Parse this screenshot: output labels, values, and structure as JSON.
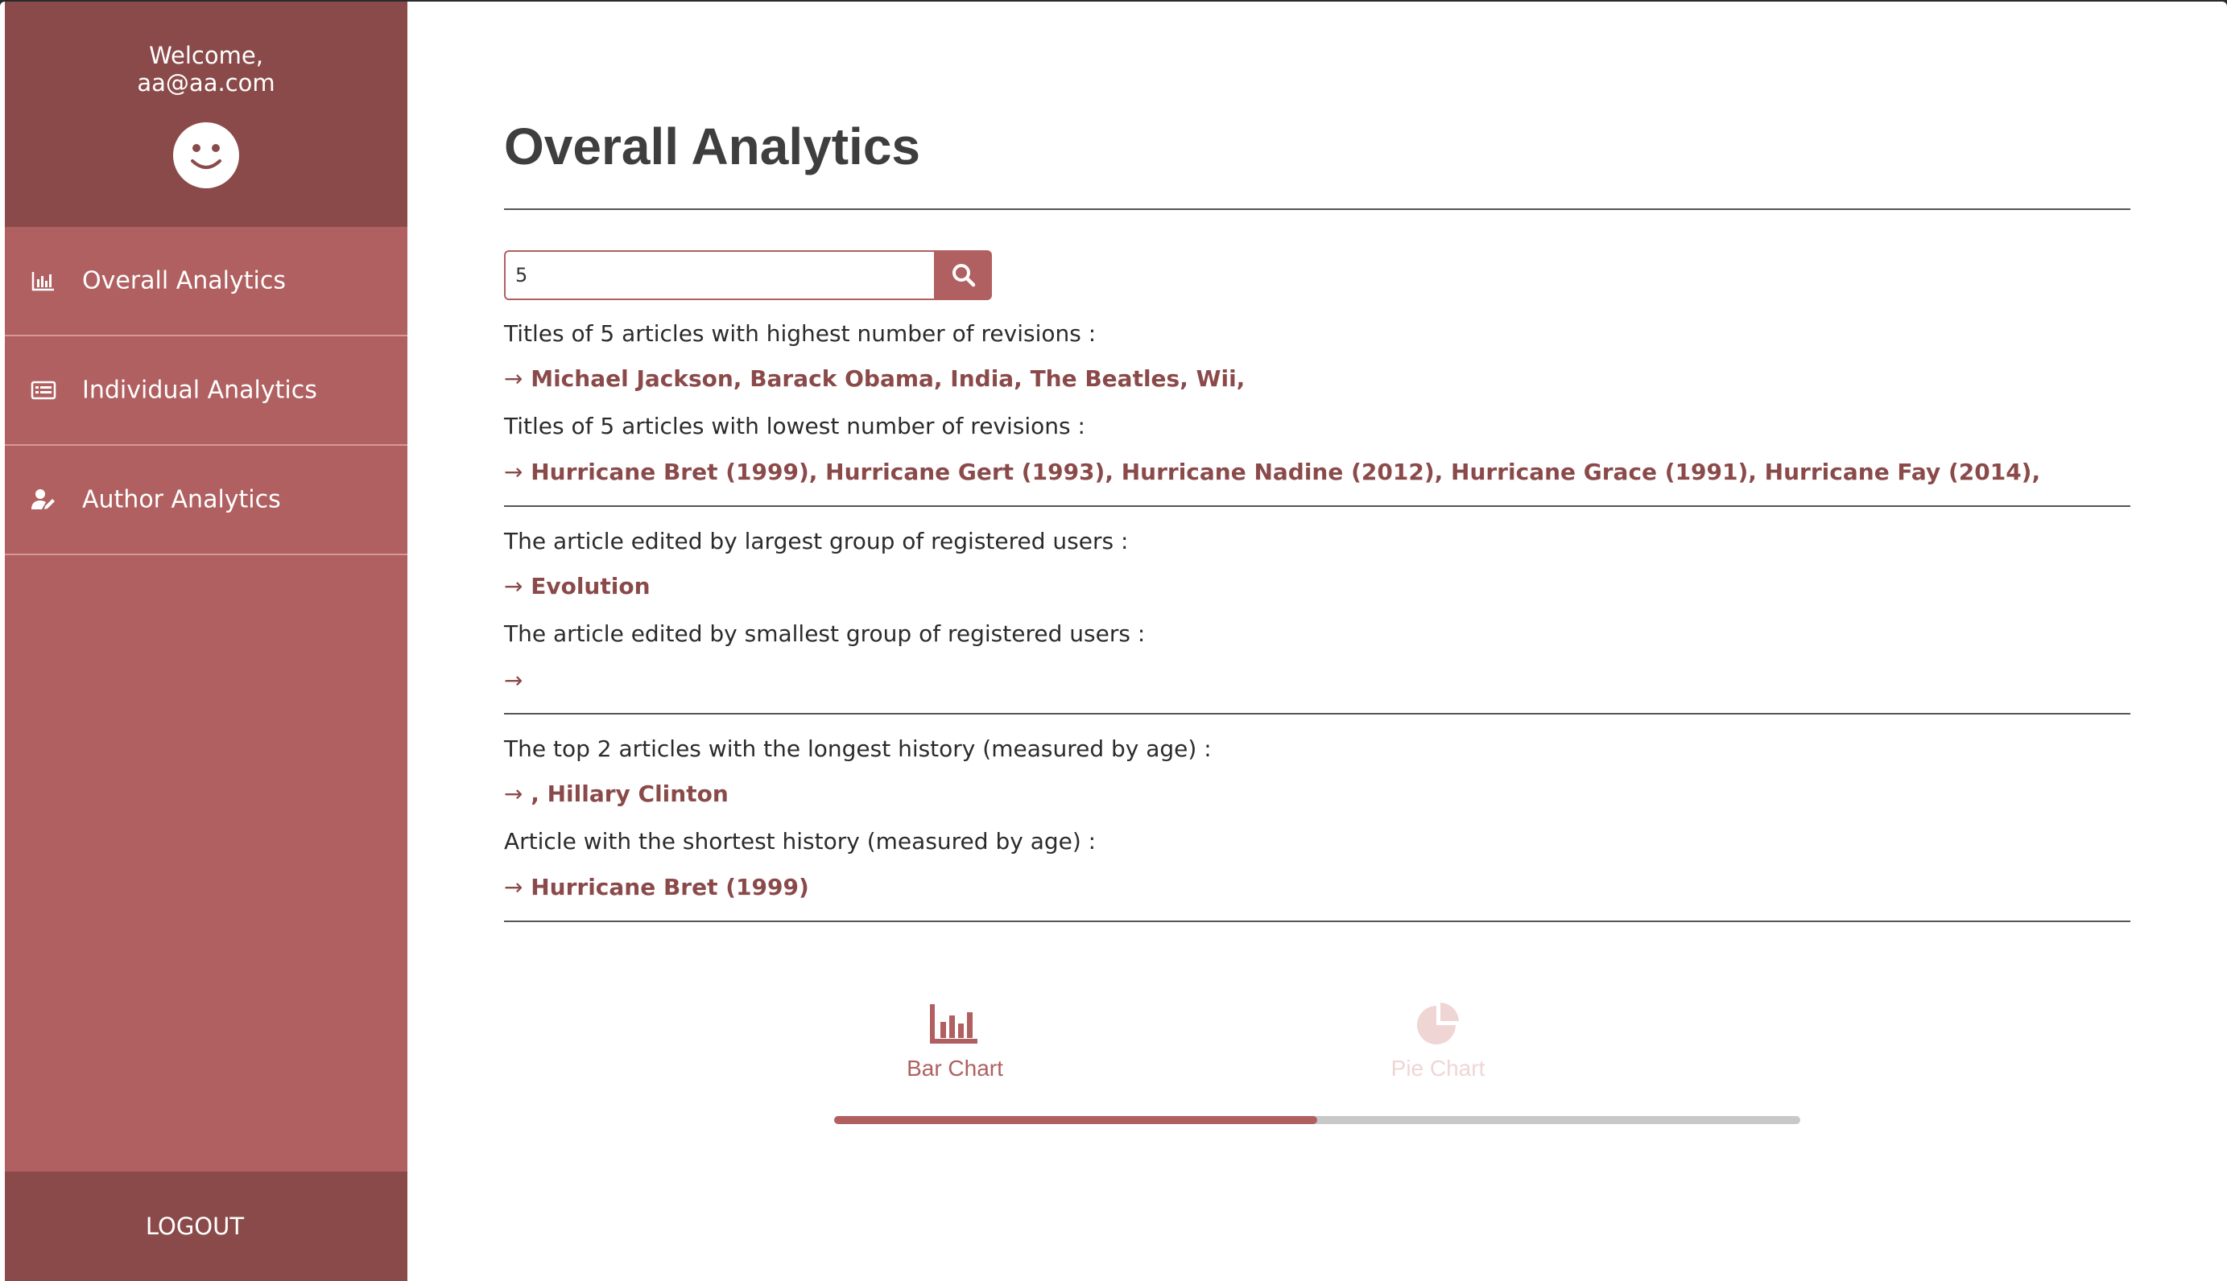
{
  "colors": {
    "sidebar": "#b06060",
    "sidebar_dark": "#8b4a4a",
    "accent": "#b06060",
    "answer_text": "#8b4a4a",
    "inactive_tab": "#f0d5d5"
  },
  "sidebar": {
    "welcome_line1": "Welcome,",
    "welcome_line2": "aa@aa.com",
    "avatar_icon": "smiley-face-icon",
    "items": [
      {
        "label": "Overall Analytics",
        "icon": "bar-chart-icon"
      },
      {
        "label": "Individual Analytics",
        "icon": "table-list-icon"
      },
      {
        "label": "Author Analytics",
        "icon": "user-edit-icon"
      }
    ],
    "logout_label": "LOGOUT"
  },
  "main": {
    "title": "Overall Analytics",
    "search": {
      "value": "5",
      "button_icon": "search-icon"
    },
    "sections": [
      {
        "question": "Titles of 5 articles with highest number of revisions :",
        "arrow": "→",
        "answer": "Michael Jackson, Barack Obama, India, The Beatles, Wii,"
      },
      {
        "question": "Titles of 5 articles with lowest number of revisions :",
        "arrow": "→",
        "answer": "Hurricane Bret (1999), Hurricane Gert (1993), Hurricane Nadine (2012), Hurricane Grace (1991), Hurricane Fay (2014),"
      },
      {
        "question": "The article edited by largest group of registered users :",
        "arrow": "→",
        "answer": "Evolution"
      },
      {
        "question": "The article edited by smallest group of registered users :",
        "arrow": "→",
        "answer": ""
      },
      {
        "question": "The top 2 articles with the longest history (measured by age) :",
        "arrow": "→",
        "answer": ", Hillary Clinton"
      },
      {
        "question": "Article with the shortest history (measured by age) :",
        "arrow": "→",
        "answer": "Hurricane Bret (1999)"
      }
    ],
    "chart_tabs": [
      {
        "label": "Bar Chart",
        "icon": "bar-chart-icon",
        "active": true
      },
      {
        "label": "Pie Chart",
        "icon": "pie-chart-icon",
        "active": false
      }
    ],
    "tab_progress": 0.5
  }
}
